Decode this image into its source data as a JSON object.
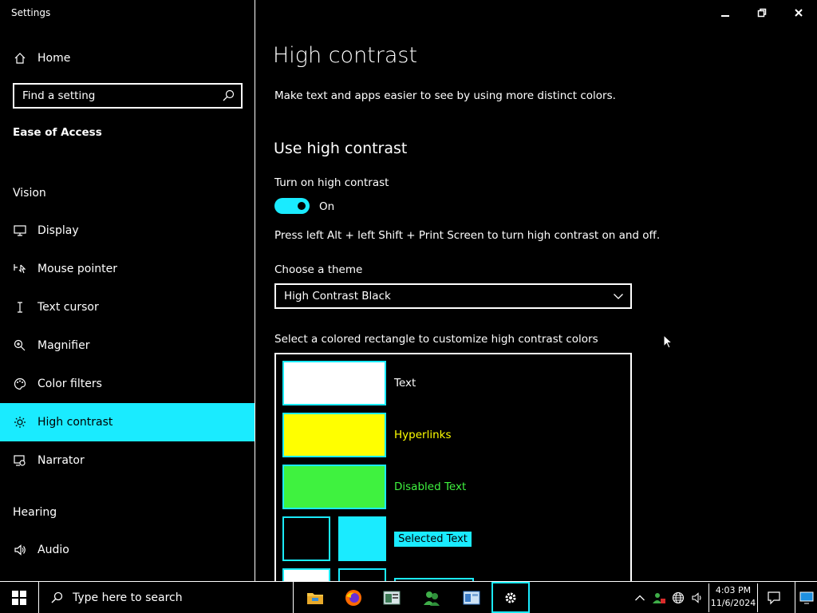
{
  "window": {
    "title": "Settings"
  },
  "sidebar": {
    "home_label": "Home",
    "search_placeholder": "Find a setting",
    "category": "Ease of Access",
    "vision_header": "Vision",
    "hearing_header": "Hearing",
    "items": [
      {
        "label": "Display",
        "icon": "monitor-icon"
      },
      {
        "label": "Mouse pointer",
        "icon": "mouse-pointer-icon"
      },
      {
        "label": "Text cursor",
        "icon": "text-cursor-icon"
      },
      {
        "label": "Magnifier",
        "icon": "magnifier-icon"
      },
      {
        "label": "Color filters",
        "icon": "palette-icon"
      },
      {
        "label": "High contrast",
        "icon": "sun-icon",
        "active": true
      },
      {
        "label": "Narrator",
        "icon": "narrator-icon"
      },
      {
        "label": "Audio",
        "icon": "speaker-icon"
      }
    ]
  },
  "main": {
    "title": "High contrast",
    "description": "Make text and apps easier to see by using more distinct colors.",
    "section_title": "Use high contrast",
    "toggle_label": "Turn on high contrast",
    "toggle_state": "On",
    "shortcut_text": "Press left Alt + left Shift + Print Screen to turn high contrast on and off.",
    "theme_label": "Choose a theme",
    "theme_value": "High Contrast Black",
    "colors_label": "Select a colored rectangle to customize high contrast colors",
    "color_items": [
      {
        "label": "Text",
        "color": "#ffffff"
      },
      {
        "label": "Hyperlinks",
        "color": "#ffff00"
      },
      {
        "label": "Disabled Text",
        "color": "#3ff23f"
      },
      {
        "label": "Selected Text",
        "color": "#1aebff",
        "background": "#000000"
      }
    ]
  },
  "taskbar": {
    "search_placeholder": "Type here to search",
    "time": "4:03 PM",
    "date": "11/6/2024"
  },
  "colors": {
    "accent": "#1aebff",
    "background": "#000000",
    "foreground": "#ffffff"
  }
}
